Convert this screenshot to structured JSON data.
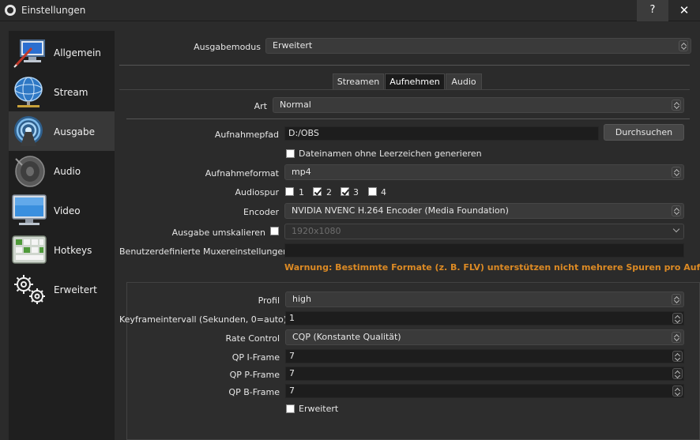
{
  "window": {
    "title": "Einstellungen",
    "help_label": "?",
    "close_label": "✕"
  },
  "sidebar": {
    "items": [
      {
        "label": "Allgemein",
        "icon": "monitor-pen-icon"
      },
      {
        "label": "Stream",
        "icon": "globe-network-icon"
      },
      {
        "label": "Ausgabe",
        "icon": "broadcast-icon"
      },
      {
        "label": "Audio",
        "icon": "speaker-icon"
      },
      {
        "label": "Video",
        "icon": "monitor-icon"
      },
      {
        "label": "Hotkeys",
        "icon": "keyboard-icon"
      },
      {
        "label": "Erweitert",
        "icon": "gears-icon"
      }
    ],
    "active_index": 2
  },
  "output": {
    "mode_label": "Ausgabemodus",
    "mode_value": "Erweitert",
    "tabs": [
      "Streamen",
      "Aufnehmen",
      "Audio"
    ],
    "active_tab": 1,
    "type_label": "Art",
    "type_value": "Normal",
    "path_label": "Aufnahmepfad",
    "path_value": "D:/OBS",
    "browse_label": "Durchsuchen",
    "no_spaces_label": "Dateinamen ohne Leerzeichen generieren",
    "no_spaces_checked": false,
    "format_label": "Aufnahmeformat",
    "format_value": "mp4",
    "audio_track_label": "Audiospur",
    "audio_tracks": [
      {
        "label": "1",
        "checked": false
      },
      {
        "label": "2",
        "checked": true
      },
      {
        "label": "3",
        "checked": true
      },
      {
        "label": "4",
        "checked": false
      }
    ],
    "encoder_label": "Encoder",
    "encoder_value": "NVIDIA NVENC H.264 Encoder (Media Foundation)",
    "rescale_label": "Ausgabe umskalieren",
    "rescale_checked": false,
    "rescale_value": "1920x1080",
    "muxer_label": "Benutzerdefinierte Muxereinstellungen",
    "muxer_value": "",
    "warning": "Warnung: Bestimmte Formate (z. B. FLV) unterstützen nicht mehrere Spuren pro Aufnahm"
  },
  "encoder_settings": {
    "profile_label": "Profil",
    "profile_value": "high",
    "keyframe_label": "Keyframeintervall (Sekunden, 0=auto)",
    "keyframe_value": "1",
    "rate_control_label": "Rate Control",
    "rate_control_value": "CQP (Konstante Qualität)",
    "qp_i_label": "QP I-Frame",
    "qp_i_value": "7",
    "qp_p_label": "QP P-Frame",
    "qp_p_value": "7",
    "qp_b_label": "QP B-Frame",
    "qp_b_value": "7",
    "advanced_label": "Erweitert",
    "advanced_checked": false
  },
  "colors": {
    "background": "#2b2b2b",
    "sidebar": "#1f1f1f",
    "active_item": "#383838",
    "warning": "#dc8a24"
  }
}
